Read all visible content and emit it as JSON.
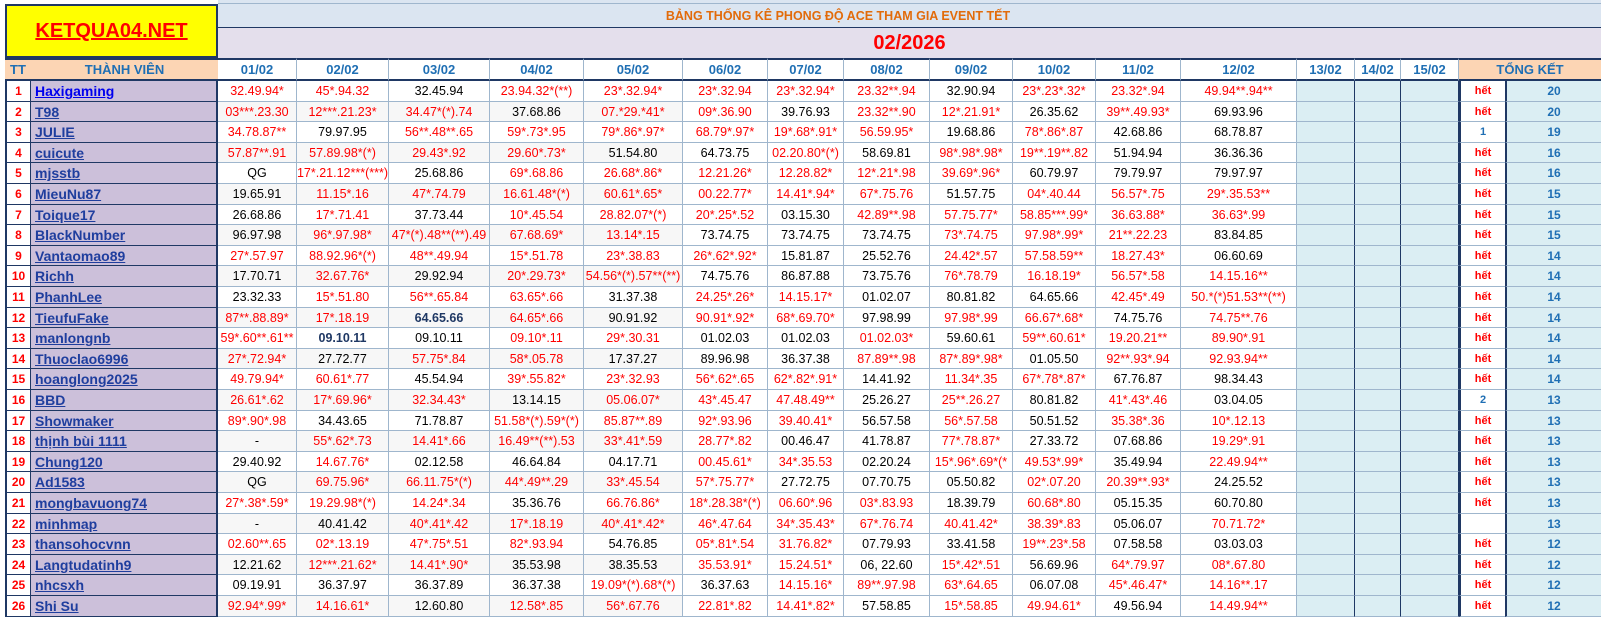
{
  "brand": "KETQUA04.NET",
  "title": "BẢNG THỐNG KÊ PHONG ĐỘ ACE THAM GIA EVENT TẾT",
  "month": "02/2026",
  "headers": {
    "tt": "TT",
    "member": "THÀNH VIÊN",
    "dates": [
      "01/02",
      "02/02",
      "03/02",
      "04/02",
      "05/02",
      "06/02",
      "07/02",
      "08/02",
      "09/02",
      "10/02",
      "11/02",
      "12/02",
      "13/02",
      "14/02",
      "15/02"
    ],
    "summary": "TỔNG KẾT"
  },
  "colors": {
    "red": "#ff0000",
    "black": "#000000",
    "navy": "#1f3864",
    "blue": "#1f6fb4"
  },
  "rows": [
    {
      "tt": "1",
      "name": "Haxigaming",
      "cells": [
        "32.49.94*",
        "45*.94.32",
        "32.45.94",
        "23.94.32*(**)",
        "23*.32.94*",
        "23*.32.94",
        "23*.32.94*",
        "23.32**.94",
        "32.90.94",
        "23*.23*.32*",
        "23.32*.94",
        "49.94**.94**"
      ],
      "kq": "hết",
      "total": "20"
    },
    {
      "tt": "2",
      "name": "T98",
      "cells": [
        "03***.23.30",
        "12***.21.23*",
        "34.47*(*).74",
        "37.68.86",
        "07.*29.*41*",
        "09*.36.90",
        "39.76.93",
        "23.32**.90",
        "12*.21.91*",
        "26.35.62",
        "39**.49.93*",
        "69.93.96"
      ],
      "kq": "hết",
      "total": "20"
    },
    {
      "tt": "3",
      "name": "JULIE",
      "cells": [
        "34.78.87**",
        "79.97.95",
        "56**.48**.65",
        "59*.73*.95",
        "79*.86*.97*",
        "68.79*.97*",
        "19*.68*.91*",
        "56.59.95*",
        "19.68.86",
        "78*.86*.87",
        "42.68.86",
        "68.78.87"
      ],
      "kq": "1",
      "total": "19"
    },
    {
      "tt": "4",
      "name": "cuicute",
      "cells": [
        "57.87**.91",
        "57.89.98*(*)",
        "29.43*.92",
        "29.60*.73*",
        "51.54.80",
        "64.73.75",
        "02.20.80*(*)",
        "58.69.81",
        "98*.98*.98*",
        "19**.19**.82",
        "51.94.94",
        "36.36.36"
      ],
      "kq": "hết",
      "total": "16"
    },
    {
      "tt": "5",
      "name": "mjsstb",
      "cells": [
        "QG",
        "17*.21.12***(***)",
        "25.68.86",
        "69*.68.86",
        "26.68*.86*",
        "12.21.26*",
        "12.28.82*",
        "12*.21*.98",
        "39.69*.96*",
        "60.79.97",
        "79.79.97",
        "79.97.97"
      ],
      "kq": "hết",
      "total": "16"
    },
    {
      "tt": "6",
      "name": "MieuNu87",
      "cells": [
        "19.65.91",
        "11.15*.16",
        "47*.74.79",
        "16.61.48*(*)",
        "60.61*.65*",
        "00.22.77*",
        "14.41*.94*",
        "67*.75.76",
        "51.57.75",
        "04*.40.44",
        "56.57*.75",
        "29*.35.53**"
      ],
      "kq": "hết",
      "total": "15"
    },
    {
      "tt": "7",
      "name": "Toique17",
      "cells": [
        "26.68.86",
        "17*.71.41",
        "37.73.44",
        "10*.45.54",
        "28.82.07*(*)",
        "20*.25*.52",
        "03.15.30",
        "42.89**.98",
        "57.75.77*",
        "58.85***.99*",
        "36.63.88*",
        "36.63*.99"
      ],
      "kq": "hết",
      "total": "15"
    },
    {
      "tt": "8",
      "name": "BlackNumber",
      "cells": [
        "96.97.98",
        "96*.97.98*",
        "47*(*).48**(**).49",
        "67.68.69*",
        "13.14*.15",
        "73.74.75",
        "73.74.75",
        "73.74.75",
        "73*.74.75",
        "97.98*.99*",
        "21**.22.23",
        "83.84.85"
      ],
      "kq": "hết",
      "total": "15"
    },
    {
      "tt": "9",
      "name": "Vantaomao89",
      "cells": [
        "27*.57.97",
        "88.92.96*(*)",
        "48**.49.94",
        "15*.51.78",
        "23*.38.83",
        "26*.62*.92*",
        "15.81.87",
        "25.52.76",
        "24.42*.57",
        "57.58.59**",
        "18.27.43*",
        "06.60.69"
      ],
      "kq": "hết",
      "total": "14"
    },
    {
      "tt": "10",
      "name": "Richh",
      "cells": [
        "17.70.71",
        "32.67.76*",
        "29.92.94",
        "20*.29.73*",
        "54.56*(*).57**(**)",
        "74.75.76",
        "86.87.88",
        "73.75.76",
        "76*.78.79",
        "16.18.19*",
        "56.57*.58",
        "14.15.16**"
      ],
      "kq": "hết",
      "total": "14"
    },
    {
      "tt": "11",
      "name": "PhanhLee",
      "cells": [
        "23.32.33",
        "15*.51.80",
        "56**.65.84",
        "63.65*.66",
        "31.37.38",
        "24.25*.26*",
        "14.15.17*",
        "01.02.07",
        "80.81.82",
        "64.65.66",
        "42.45*.49",
        "50.*(*)51.53**(**)"
      ],
      "kq": "hết",
      "total": "14"
    },
    {
      "tt": "12",
      "name": "TieufuFake",
      "cells": [
        "87**.88.89*",
        "17*.18.19",
        "64.65.66",
        "64.65*.66",
        "90.91.92",
        "90.91*.92*",
        "68*.69.70*",
        "97.98.99",
        "97.98*.99",
        "66.67*.68*",
        "74.75.76",
        "74.75**.76"
      ],
      "kq": "hết",
      "total": "14"
    },
    {
      "tt": "13",
      "name": "manlongnb",
      "cells": [
        "59*.60**.61**",
        "09.10.11",
        "09.10.11",
        "09.10*.11",
        "29*.30.31",
        "01.02.03",
        "01.02.03",
        "01.02.03*",
        "59.60.61",
        "59**.60.61*",
        "19.20.21**",
        "89.90*.91"
      ],
      "kq": "hết",
      "total": "14"
    },
    {
      "tt": "14",
      "name": "Thuoclao6996",
      "cells": [
        "27*.72.94*",
        "27.72.77",
        "57.75*.84",
        "58*.05.78",
        "17.37.27",
        "89.96.98",
        "36.37.38",
        "87.89**.98",
        "87*.89*.98*",
        "01.05.50",
        "92**.93*.94",
        "92.93.94**"
      ],
      "kq": "hết",
      "total": "14"
    },
    {
      "tt": "15",
      "name": "hoanglong2025",
      "cells": [
        "49.79.94*",
        "60.61*.77",
        "45.54.94",
        "39*.55.82*",
        "23*.32.93",
        "56*.62*.65",
        "62*.82*.91*",
        "14.41.92",
        "11.34*.35",
        "67*.78*.87*",
        "67.76.87",
        "98.34.43"
      ],
      "kq": "hết",
      "total": "14"
    },
    {
      "tt": "16",
      "name": "BBD",
      "cells": [
        "26.61*.62",
        "17*.69.96*",
        "32.34.43*",
        "13.14.15",
        "05.06.07*",
        "43*.45.47",
        "47.48.49**",
        "25.26.27",
        "25**.26.27",
        "80.81.82",
        "41*.43*.46",
        "03.04.05"
      ],
      "kq": "2",
      "total": "13"
    },
    {
      "tt": "17",
      "name": "Showmaker",
      "cells": [
        "89*.90*.98",
        "34.43.65",
        "71.78.87",
        "51.58*(*).59*(*)",
        "85.87**.89",
        "92*.93.96",
        "39.40.41*",
        "56.57.58",
        "56*.57.58",
        "50.51.52",
        "35.38*.36",
        "10*.12.13"
      ],
      "kq": "hết",
      "total": "13"
    },
    {
      "tt": "18",
      "name": "thịnh bùi 1111",
      "cells": [
        "-",
        "55*.62*.73",
        "14.41*.66",
        "16.49**(**).53",
        "33*.41*.59",
        "28.77*.82",
        "00.46.47",
        "41.78.87",
        "77*.78.87*",
        "27.33.72",
        "07.68.86",
        "19.29*.91"
      ],
      "kq": "hết",
      "total": "13"
    },
    {
      "tt": "19",
      "name": "Chung120",
      "cells": [
        "29.40.92",
        "14.67.76*",
        "02.12.58",
        "46.64.84",
        "04.17.71",
        "00.45.61*",
        "34*.35.53",
        "02.20.24",
        "15*.96*.69*(*",
        "49.53*.99*",
        "35.49.94",
        "22.49.94**"
      ],
      "kq": "hết",
      "total": "13"
    },
    {
      "tt": "20",
      "name": "Ad1583",
      "cells": [
        "QG",
        "69.75.96*",
        "66.11.75*(*)",
        "44*.49**.29",
        "33*.45.54",
        "57*.75.77*",
        "27.72.75",
        "07.70.75",
        "05.50.82",
        "02*.07.20",
        "20.39**.93*",
        "24.25.52"
      ],
      "kq": "hết",
      "total": "13"
    },
    {
      "tt": "21",
      "name": "mongbavuong74",
      "cells": [
        "27*.38*.59*",
        "19.29.98*(*)",
        "14.24*.34",
        "35.36.76",
        "66.76.86*",
        "18*.28.38*(*)",
        "06.60*.96",
        "03*.83.93",
        "18.39.79",
        "60.68*.80",
        "05.15.35",
        "60.70.80"
      ],
      "kq": "hết",
      "total": "13"
    },
    {
      "tt": "22",
      "name": "minhmap",
      "cells": [
        "-",
        "40.41.42",
        "40*.41*.42",
        "17*.18.19",
        "40*.41*.42*",
        "46*.47.64",
        "34*.35.43*",
        "67*.76.74",
        "40.41.42*",
        "38.39*.83",
        "05.06.07",
        "70.71.72*"
      ],
      "kq": "",
      "total": "13"
    },
    {
      "tt": "23",
      "name": "thansohocvnn",
      "cells": [
        "02.60**.65",
        "02*.13.19",
        "47*.75*.51",
        "82*.93.94",
        "54.76.85",
        "05*.81*.54",
        "31.76.82*",
        "07.79.93",
        "33.41.58",
        "19**.23*.58",
        "07.58.58",
        "03.03.03"
      ],
      "kq": "hết",
      "total": "12"
    },
    {
      "tt": "24",
      "name": "Langtudatinh9",
      "cells": [
        "12.21.62",
        "12***.21.62*",
        "14.41*.90*",
        "35.53.98",
        "38.35.53",
        "35.53.91*",
        "15.24.51*",
        "06, 22.60",
        "15*.42*.51",
        "56.69.96",
        "64*.79.97",
        "08*.67.80"
      ],
      "kq": "hết",
      "total": "12"
    },
    {
      "tt": "25",
      "name": "nhcsxh",
      "cells": [
        "09.19.91",
        "36.37.97",
        "36.37.89",
        "36.37.38",
        "19.09*(*).68*(*)",
        "36.37.63",
        "14.15.16*",
        "89**.97.98",
        "63*.64.65",
        "06.07.08",
        "45*.46.47*",
        "14.16**.17"
      ],
      "kq": "hết",
      "total": "12"
    },
    {
      "tt": "26",
      "name": "Shi Su",
      "cells": [
        "92.94*.99*",
        "14.16.61*",
        "12.60.80",
        "12.58*.85",
        "56*.67.76",
        "22.81*.82",
        "14.41*.82*",
        "57.58.85",
        "15*.58.85",
        "49.94.61*",
        "49.56.94",
        "14.49.94**"
      ],
      "kq": "hết",
      "total": "12"
    }
  ],
  "cell_colors": [
    [
      "r",
      "r",
      "k",
      "r",
      "r",
      "r",
      "r",
      "r",
      "k",
      "r",
      "r",
      "r"
    ],
    [
      "r",
      "r",
      "r",
      "k",
      "r",
      "r",
      "k",
      "r",
      "r",
      "k",
      "r",
      "k"
    ],
    [
      "r",
      "k",
      "r",
      "r",
      "r",
      "r",
      "r",
      "r",
      "k",
      "r",
      "k",
      "k"
    ],
    [
      "r",
      "r",
      "r",
      "r",
      "k",
      "k",
      "r",
      "k",
      "r",
      "r",
      "k",
      "k"
    ],
    [
      "k",
      "r",
      "k",
      "r",
      "r",
      "r",
      "r",
      "r",
      "r",
      "k",
      "k",
      "k"
    ],
    [
      "k",
      "r",
      "r",
      "r",
      "r",
      "r",
      "r",
      "r",
      "k",
      "r",
      "r",
      "r"
    ],
    [
      "k",
      "r",
      "k",
      "r",
      "r",
      "r",
      "k",
      "r",
      "r",
      "r",
      "r",
      "r"
    ],
    [
      "k",
      "r",
      "r",
      "r",
      "r",
      "k",
      "k",
      "k",
      "r",
      "r",
      "r",
      "k"
    ],
    [
      "r",
      "r",
      "r",
      "r",
      "r",
      "r",
      "k",
      "k",
      "r",
      "r",
      "r",
      "k"
    ],
    [
      "k",
      "r",
      "k",
      "r",
      "r",
      "k",
      "k",
      "k",
      "r",
      "r",
      "r",
      "r"
    ],
    [
      "k",
      "r",
      "r",
      "r",
      "k",
      "r",
      "r",
      "k",
      "k",
      "k",
      "r",
      "r"
    ],
    [
      "r",
      "r",
      "n",
      "r",
      "k",
      "r",
      "r",
      "k",
      "r",
      "r",
      "k",
      "r"
    ],
    [
      "r",
      "n",
      "k",
      "r",
      "r",
      "k",
      "k",
      "r",
      "k",
      "r",
      "r",
      "r"
    ],
    [
      "r",
      "k",
      "r",
      "r",
      "k",
      "k",
      "k",
      "r",
      "r",
      "k",
      "r",
      "r"
    ],
    [
      "r",
      "r",
      "k",
      "r",
      "r",
      "r",
      "r",
      "k",
      "r",
      "r",
      "k",
      "k"
    ],
    [
      "r",
      "r",
      "r",
      "k",
      "r",
      "r",
      "r",
      "k",
      "r",
      "k",
      "r",
      "k"
    ],
    [
      "r",
      "k",
      "k",
      "r",
      "r",
      "r",
      "r",
      "k",
      "r",
      "k",
      "r",
      "r"
    ],
    [
      "k",
      "r",
      "r",
      "r",
      "r",
      "r",
      "k",
      "k",
      "r",
      "k",
      "k",
      "r"
    ],
    [
      "k",
      "r",
      "k",
      "k",
      "k",
      "r",
      "r",
      "k",
      "r",
      "r",
      "k",
      "r"
    ],
    [
      "k",
      "r",
      "r",
      "r",
      "r",
      "r",
      "k",
      "k",
      "k",
      "r",
      "r",
      "k"
    ],
    [
      "r",
      "r",
      "r",
      "k",
      "r",
      "r",
      "r",
      "r",
      "k",
      "r",
      "k",
      "k"
    ],
    [
      "k",
      "k",
      "r",
      "r",
      "r",
      "r",
      "r",
      "r",
      "r",
      "r",
      "k",
      "r"
    ],
    [
      "r",
      "r",
      "r",
      "r",
      "k",
      "r",
      "r",
      "k",
      "k",
      "r",
      "k",
      "k"
    ],
    [
      "k",
      "r",
      "r",
      "k",
      "k",
      "r",
      "r",
      "k",
      "r",
      "k",
      "r",
      "r"
    ],
    [
      "k",
      "k",
      "k",
      "k",
      "r",
      "k",
      "r",
      "r",
      "r",
      "k",
      "r",
      "r"
    ],
    [
      "r",
      "r",
      "k",
      "r",
      "r",
      "r",
      "r",
      "k",
      "r",
      "r",
      "k",
      "r"
    ]
  ]
}
